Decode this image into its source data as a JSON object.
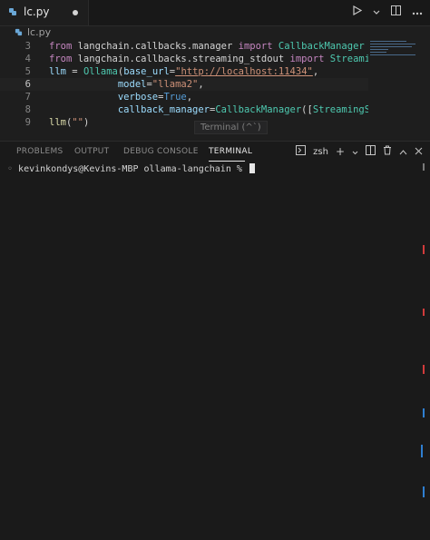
{
  "tab": {
    "filename": "lc.py"
  },
  "breadcrumb": {
    "file": "lc.py"
  },
  "editor": {
    "lines": [
      {
        "num": "3",
        "tokens": [
          {
            "t": "from ",
            "c": "kw"
          },
          {
            "t": "langchain.callbacks.manager ",
            "c": "op"
          },
          {
            "t": "import ",
            "c": "kw"
          },
          {
            "t": "CallbackManager",
            "c": "cls"
          }
        ]
      },
      {
        "num": "4",
        "tokens": [
          {
            "t": "from ",
            "c": "kw"
          },
          {
            "t": "langchain.callbacks.streaming_stdout ",
            "c": "op"
          },
          {
            "t": "import ",
            "c": "kw"
          },
          {
            "t": "StreamingStdOu",
            "c": "cls"
          }
        ]
      },
      {
        "num": "5",
        "tokens": [
          {
            "t": "llm ",
            "c": "var"
          },
          {
            "t": "= ",
            "c": "op"
          },
          {
            "t": "Ollama",
            "c": "cls"
          },
          {
            "t": "(",
            "c": "op"
          },
          {
            "t": "base_url",
            "c": "var"
          },
          {
            "t": "=",
            "c": "op"
          },
          {
            "t": "\"http://localhost:11434\"",
            "c": "str url"
          },
          {
            "t": ",",
            "c": "op"
          }
        ]
      },
      {
        "num": "6",
        "tokens": [
          {
            "t": "            ",
            "c": "op"
          },
          {
            "t": "model",
            "c": "var"
          },
          {
            "t": "=",
            "c": "op"
          },
          {
            "t": "\"llama2\"",
            "c": "str"
          },
          {
            "t": ",",
            "c": "op"
          }
        ]
      },
      {
        "num": "7",
        "tokens": [
          {
            "t": "            ",
            "c": "op"
          },
          {
            "t": "verbose",
            "c": "var"
          },
          {
            "t": "=",
            "c": "op"
          },
          {
            "t": "True",
            "c": "const"
          },
          {
            "t": ",",
            "c": "op"
          }
        ]
      },
      {
        "num": "8",
        "tokens": [
          {
            "t": "            ",
            "c": "op"
          },
          {
            "t": "callback_manager",
            "c": "var"
          },
          {
            "t": "=",
            "c": "op"
          },
          {
            "t": "CallbackManager",
            "c": "cls"
          },
          {
            "t": "([",
            "c": "op"
          },
          {
            "t": "StreamingStdOutC",
            "c": "cls"
          }
        ]
      },
      {
        "num": "9",
        "tokens": [
          {
            "t": "llm",
            "c": "fn"
          },
          {
            "t": "(",
            "c": "op"
          },
          {
            "t": "\"\"",
            "c": "str"
          },
          {
            "t": ")",
            "c": "op"
          }
        ]
      }
    ],
    "current_line": "6",
    "tooltip": "Terminal (^`)"
  },
  "panel": {
    "tabs": [
      {
        "label": "PROBLEMS"
      },
      {
        "label": "OUTPUT"
      },
      {
        "label": "DEBUG CONSOLE"
      },
      {
        "label": "TERMINAL"
      }
    ],
    "shell": "zsh",
    "terminal_prompt": "kevinkondys@Kevins-MBP ollama-langchain % "
  },
  "icons": {
    "tab_file": "python-file-icon",
    "run": "run-icon",
    "split": "split-editor-icon",
    "more": "more-icon"
  }
}
